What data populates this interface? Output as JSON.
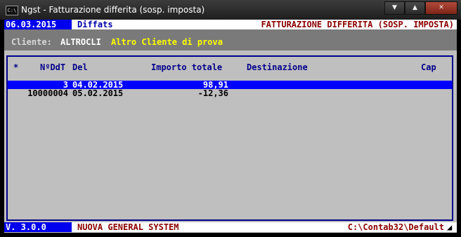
{
  "window": {
    "title": "Ngst - Fatturazione differita (sosp. imposta)",
    "icon_text": "C:\\",
    "buttons": {
      "minimize": "▼",
      "restore": "▲",
      "close": "✕"
    }
  },
  "status_top": {
    "date": "06.03.2015",
    "program": "Diffats",
    "title": "FATTURAZIONE DIFFERITA (SOSP. IMPOSTA)"
  },
  "client": {
    "label": "Cliente:",
    "code": "ALTROCLI",
    "name": "Altro Cliente di prova"
  },
  "table": {
    "columns": [
      "*",
      "NºDdT",
      "Del",
      "Importo totale",
      "Destinazione",
      "Cap"
    ],
    "rows": [
      {
        "number": "3",
        "date": "04.02.2015",
        "amount": "98,91",
        "selected": true
      },
      {
        "number": "10000004",
        "date": "05.02.2015",
        "amount": "-12,36",
        "selected": false
      }
    ]
  },
  "status_bottom": {
    "version": "V. 3.0.0",
    "system": "NUOVA GENERAL SYSTEM",
    "path": "C:\\Contab32\\Default"
  },
  "colors": {
    "console_bg": "#bfbfbf",
    "blue": "#0000ee",
    "dark_blue": "#00008b",
    "dark_red": "#8b0000",
    "yellow": "#ffff00",
    "client_bar": "#7a7a7a"
  }
}
